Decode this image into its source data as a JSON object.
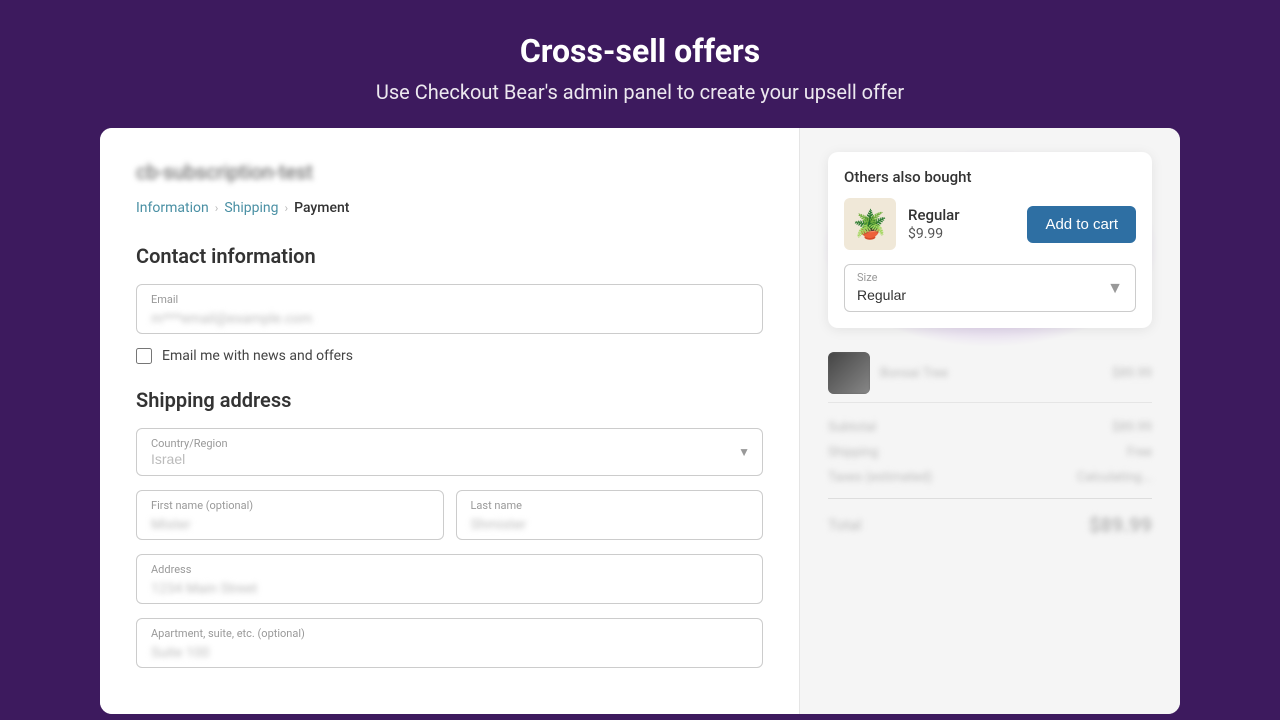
{
  "page": {
    "title": "Cross-sell offers",
    "subtitle": "Use Checkout Bear's admin panel to create your upsell offer"
  },
  "left_panel": {
    "store_name": "cb-subscription-test",
    "breadcrumb": {
      "items": [
        {
          "label": "Information",
          "active": true
        },
        {
          "label": "Shipping",
          "active": false
        },
        {
          "label": "Payment",
          "active": false
        }
      ]
    },
    "contact_section": {
      "title": "Contact information",
      "email_label": "Email",
      "email_placeholder": "m***email@example.com",
      "email_checkbox_label": "Email me with news and offers"
    },
    "shipping_section": {
      "title": "Shipping address",
      "country_label": "Country/Region",
      "country_value": "Israel",
      "first_name_label": "First name (optional)",
      "first_name_value": "Mister",
      "last_name_label": "Last name",
      "last_name_value": "Shmister",
      "address_label": "Address",
      "address_value": "1234 Main Street",
      "apartment_label": "Apartment, suite, etc. (optional)",
      "apartment_value": "Suite 100"
    }
  },
  "right_panel": {
    "crosssell": {
      "title": "Others also bought",
      "product": {
        "name": "Regular",
        "price": "$9.99",
        "emoji": "🪴"
      },
      "button_label": "Add to cart",
      "size_label": "Size",
      "size_value": "Regular"
    },
    "order_item": {
      "name": "Bonsai Tree",
      "price": "$89.99"
    },
    "summary": {
      "subtotal_label": "Subtotal",
      "subtotal_value": "$89.99",
      "shipping_label": "Shipping",
      "shipping_value": "Free",
      "taxes_label": "Taxes (estimated)",
      "taxes_value": "Calculating...",
      "total_label": "Total",
      "total_value": "$89.99"
    }
  }
}
